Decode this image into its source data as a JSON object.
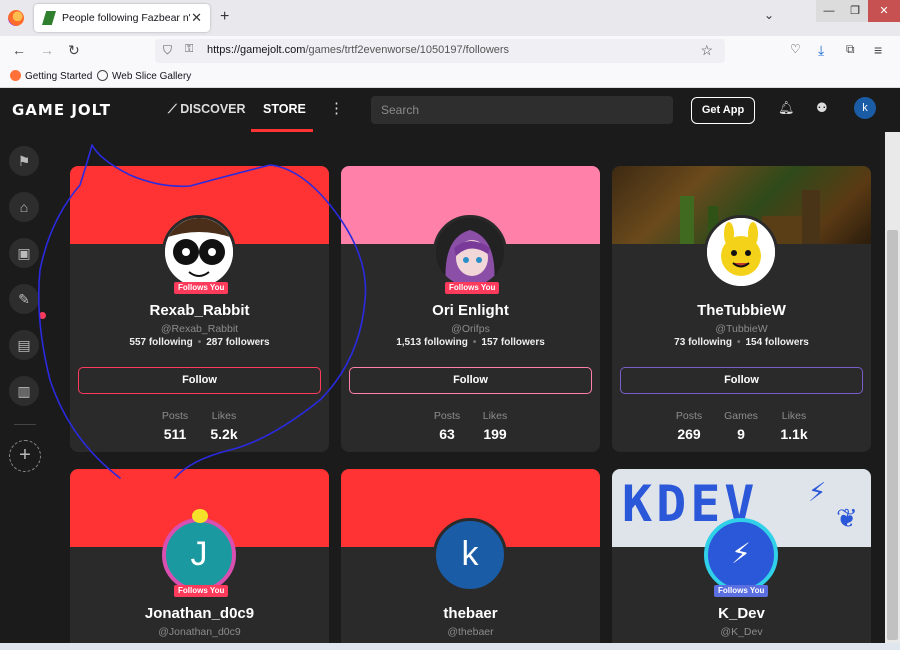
{
  "browser": {
    "tab_title": "People following Fazbear n' Fri",
    "url_host": "https://gamejolt.com",
    "url_path": "/games/trtf2evenworse/1050197/followers",
    "bookmarks": [
      "Getting Started",
      "Web Slice Gallery"
    ]
  },
  "gamejolt": {
    "logo": "GAME JOLT",
    "nav": {
      "discover": "DISCOVER",
      "store": "STORE"
    },
    "search_placeholder": "Search",
    "get_app": "Get App",
    "user_initial": "k"
  },
  "colors": {
    "accent": "#ff3333",
    "bg": "#1b1b1b",
    "card": "#2a2a2a",
    "follows_badge": "#ff3b5c"
  },
  "cards": [
    {
      "name": "Rexab_Rabbit",
      "handle": "@Rexab_Rabbit",
      "following": "557 following",
      "followers": "287 followers",
      "follows_you": "Follows You",
      "follow_label": "Follow",
      "banner_color": "#ff3333",
      "stats": [
        {
          "label": "Posts",
          "value": "511"
        },
        {
          "label": "Likes",
          "value": "5.2k"
        }
      ]
    },
    {
      "name": "Ori Enlight",
      "handle": "@Orifps",
      "following": "1,513 following",
      "followers": "157 followers",
      "follows_you": "Follows You",
      "follow_label": "Follow",
      "banner_color": "#ff80a8",
      "stats": [
        {
          "label": "Posts",
          "value": "63"
        },
        {
          "label": "Likes",
          "value": "199"
        }
      ]
    },
    {
      "name": "TheTubbieW",
      "handle": "@TubbieW",
      "following": "73 following",
      "followers": "154 followers",
      "follow_label": "Follow",
      "stats": [
        {
          "label": "Posts",
          "value": "269"
        },
        {
          "label": "Games",
          "value": "9"
        },
        {
          "label": "Likes",
          "value": "1.1k"
        }
      ]
    },
    {
      "name": "Jonathan_d0c9",
      "handle": "@Jonathan_d0c9",
      "follows_you": "Follows You",
      "avatar_letter": "J",
      "banner_color": "#ff3333"
    },
    {
      "name": "thebaer",
      "handle": "@thebaer",
      "avatar_letter": "k",
      "banner_color": "#ff3333"
    },
    {
      "name": "K_Dev",
      "handle": "@K_Dev",
      "follows_you": "Follows You",
      "banner_text": "KDEV"
    }
  ]
}
